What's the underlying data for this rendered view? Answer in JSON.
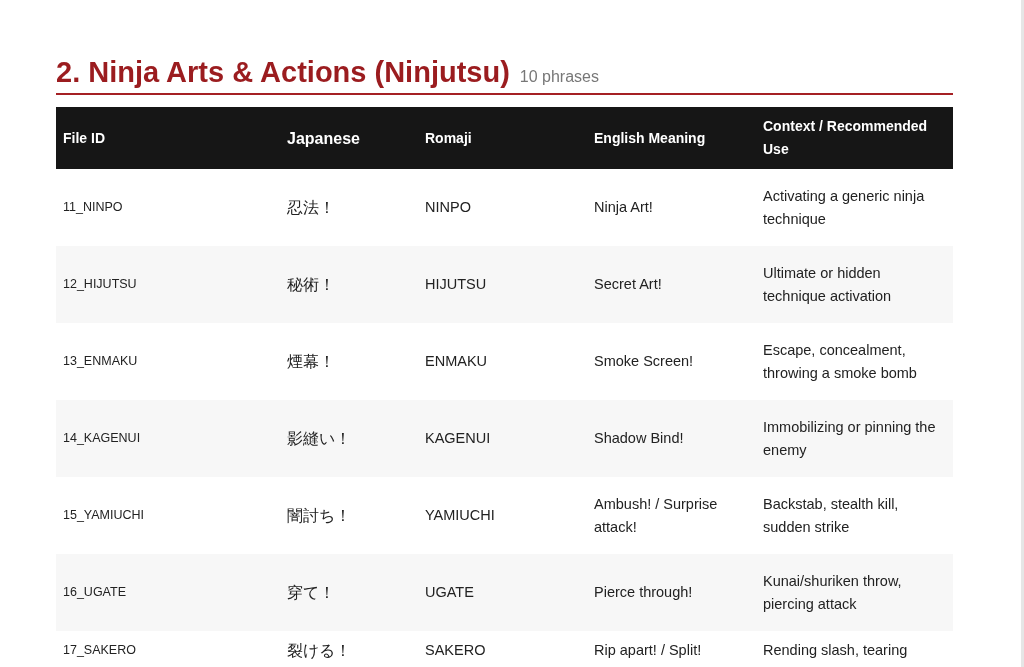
{
  "section": {
    "title": "2. Ninja Arts & Actions (Ninjutsu)",
    "count": "10 phrases"
  },
  "table": {
    "columns": [
      "File ID",
      "Japanese",
      "Romaji",
      "English Meaning",
      "Context / Recommended Use"
    ],
    "rows": [
      [
        "11_NINPO",
        "忍法！",
        "NINPO",
        "Ninja Art!",
        "Activating a generic ninja technique"
      ],
      [
        "12_HIJUTSU",
        "秘術！",
        "HIJUTSU",
        "Secret Art!",
        "Ultimate or hidden technique activation"
      ],
      [
        "13_ENMAKU",
        "煙幕！",
        "ENMAKU",
        "Smoke Screen!",
        "Escape, concealment, throwing a smoke bomb"
      ],
      [
        "14_KAGENUI",
        "影縫い！",
        "KAGENUI",
        "Shadow Bind!",
        "Immobilizing or pinning the enemy"
      ],
      [
        "15_YAMIUCHI",
        "闇討ち！",
        "YAMIUCHI",
        "Ambush! / Surprise attack!",
        "Backstab, stealth kill, sudden strike"
      ],
      [
        "16_UGATE",
        "穿て！",
        "UGATE",
        "Pierce through!",
        "Kunai/shuriken throw, piercing attack"
      ],
      [
        "17_SAKERO",
        "裂ける！",
        "SAKERO",
        "Rip apart! / Split!",
        "Rending slash, tearing"
      ]
    ]
  }
}
